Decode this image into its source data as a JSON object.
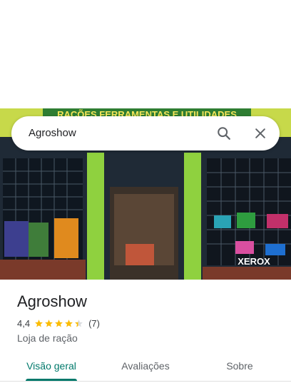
{
  "search": {
    "query": "Agroshow"
  },
  "photo": {
    "sign_text": "RAÇÕES FERRAMENTAS E UTILIDADES",
    "xerox_text": "XEROX"
  },
  "place": {
    "name": "Agroshow",
    "rating": "4,4",
    "rating_value": 4.4,
    "reviews": "(7)",
    "category": "Loja de ração"
  },
  "tabs": [
    {
      "label": "Visão geral",
      "active": true
    },
    {
      "label": "Avaliações",
      "active": false
    },
    {
      "label": "Sobre",
      "active": false
    }
  ],
  "colors": {
    "accent": "#00796b",
    "star": "#fbbc04",
    "star_empty": "#dadce0"
  }
}
